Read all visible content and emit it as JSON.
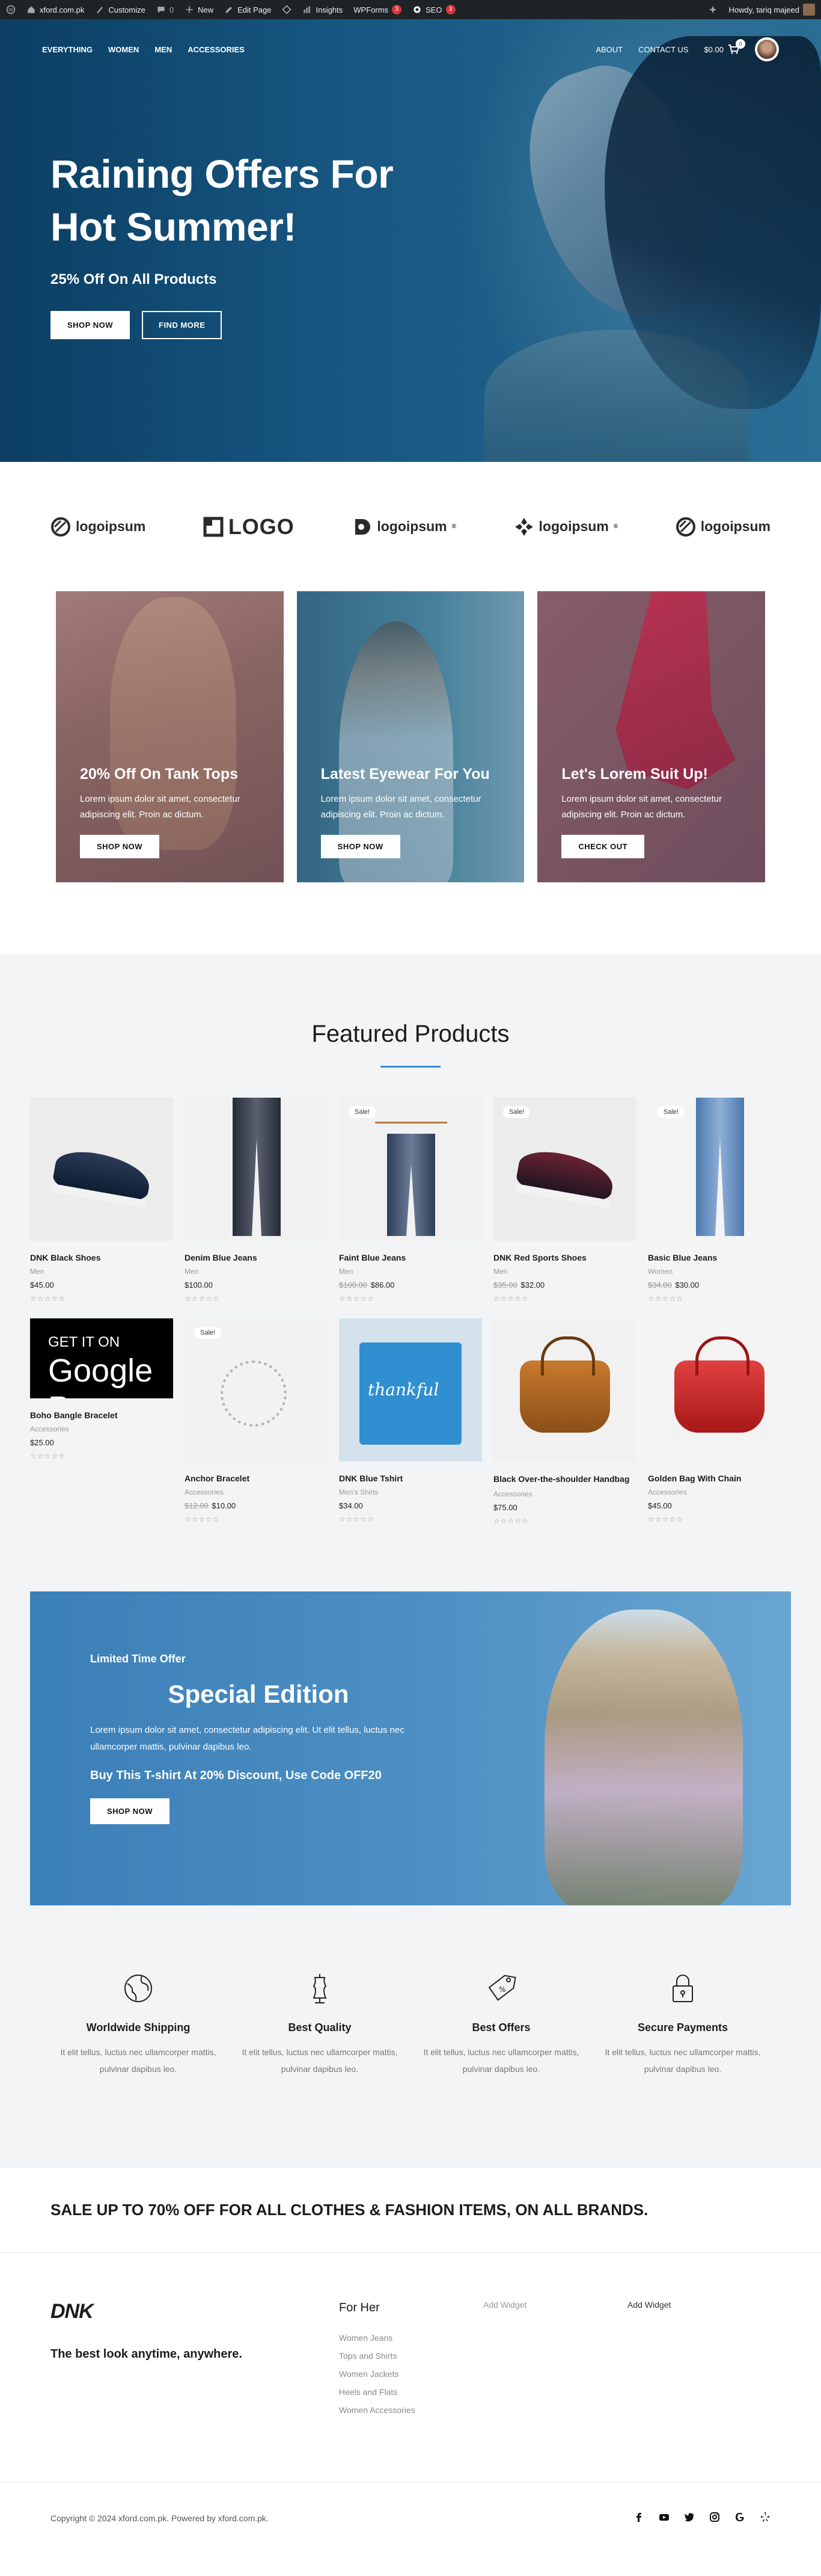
{
  "adminbar": {
    "site": "xford.com.pk",
    "customize": "Customize",
    "comments": "0",
    "new": "New",
    "edit": "Edit Page",
    "insights": "Insights",
    "wpforms": "WPForms",
    "wpforms_count": "3",
    "seo": "SEO",
    "seo_count": "3",
    "howdy": "Howdy, tariq majeed"
  },
  "nav": {
    "links": [
      "EVERYTHING",
      "WOMEN",
      "MEN",
      "ACCESSORIES"
    ],
    "right": [
      "ABOUT",
      "CONTACT US"
    ],
    "cart_total": "$0.00",
    "cart_count": "0"
  },
  "hero": {
    "line1": "Raining Offers For",
    "line2": "Hot Summer!",
    "subtitle": "25% Off On All Products",
    "btn_shop": "SHOP NOW",
    "btn_find": "FIND MORE"
  },
  "logos": [
    {
      "text": "logoipsum",
      "icon": "circle-slash-logo-icon"
    },
    {
      "text": "LOGO",
      "icon": "square-logo-icon"
    },
    {
      "text": "logoipsum",
      "icon": "half-moon-logo-icon",
      "tm": "®"
    },
    {
      "text": "logoipsum",
      "icon": "diamond-dots-logo-icon",
      "tm": "®"
    },
    {
      "text": "logoipsum",
      "icon": "circle-slash-logo-icon"
    }
  ],
  "promos": [
    {
      "title": "20% Off On Tank Tops",
      "desc": "Lorem ipsum dolor sit amet, consectetur adipiscing elit. Proin ac dictum.",
      "btn": "SHOP NOW"
    },
    {
      "title": "Latest Eyewear For You",
      "desc": "Lorem ipsum dolor sit amet, consectetur adipiscing elit. Proin ac dictum.",
      "btn": "SHOP NOW"
    },
    {
      "title": "Let's Lorem Suit Up!",
      "desc": "Lorem ipsum dolor sit amet, consectetur adipiscing elit. Proin ac dictum.",
      "btn": "CHECK OUT"
    }
  ],
  "featured": {
    "title": "Featured Products",
    "stars": "☆☆☆☆☆",
    "sale_label": "Sale!",
    "products": [
      {
        "name": "DNK Black Shoes",
        "cat": "Men",
        "price": "$45.00",
        "old": ""
      },
      {
        "name": "Denim Blue Jeans",
        "cat": "Men",
        "price": "$100.00",
        "old": ""
      },
      {
        "name": "Faint Blue Jeans",
        "cat": "Men",
        "price": "$86.00",
        "old": "$100.00"
      },
      {
        "name": "DNK Red Sports Shoes",
        "cat": "Men",
        "price": "$32.00",
        "old": "$35.00"
      },
      {
        "name": "Basic Blue Jeans",
        "cat": "Women",
        "price": "$30.00",
        "old": "$34.00"
      },
      {
        "name": "Boho Bangle Bracelet",
        "cat": "Accessories",
        "price": "$25.00",
        "old": ""
      },
      {
        "name": "Anchor Bracelet",
        "cat": "Accessories",
        "price": "$10.00",
        "old": "$12.00"
      },
      {
        "name": "DNK Blue Tshirt",
        "cat": "Men's Shirts",
        "price": "$34.00",
        "old": ""
      },
      {
        "name": "Black Over-the-shoulder Handbag",
        "cat": "Accessories",
        "price": "$75.00",
        "old": ""
      },
      {
        "name": "Golden Bag With Chain",
        "cat": "Accessories",
        "price": "$45.00",
        "old": ""
      }
    ],
    "google_t1": "GET IT ON",
    "google_t2": "Google P",
    "tshirt_text": "thankful"
  },
  "special": {
    "tag": "Limited Time Offer",
    "title": "Special Edition",
    "desc": "Lorem ipsum dolor sit amet, consectetur adipiscing elit. Ut elit tellus, luctus nec ullamcorper mattis, pulvinar dapibus leo.",
    "offer": "Buy This T-shirt At 20% Discount, Use Code OFF20",
    "btn": "SHOP NOW"
  },
  "features": [
    {
      "title": "Worldwide Shipping",
      "desc": "It elit tellus, luctus nec ullamcorper mattis, pulvinar dapibus leo.",
      "icon": "globe-icon"
    },
    {
      "title": "Best Quality",
      "desc": "It elit tellus, luctus nec ullamcorper mattis, pulvinar dapibus leo.",
      "icon": "dress-form-icon"
    },
    {
      "title": "Best Offers",
      "desc": "It elit tellus, luctus nec ullamcorper mattis, pulvinar dapibus leo.",
      "icon": "price-tag-icon"
    },
    {
      "title": "Secure Payments",
      "desc": "It elit tellus, luctus nec ullamcorper mattis, pulvinar dapibus leo.",
      "icon": "padlock-icon"
    }
  ],
  "salebar": "SALE UP TO 70% OFF FOR ALL CLOTHES & FASHION ITEMS, ON ALL BRANDS.",
  "footer": {
    "logo": "DNK",
    "tagline": "The best look anytime, anywhere.",
    "for_her": "For Her",
    "links": [
      "Women Jeans",
      "Tops and Shirts",
      "Women Jackets",
      "Heels and Flats",
      "Women Accessories"
    ],
    "widget1": "Add Widget",
    "widget2": "Add Widget",
    "copyright": "Copyright © 2024 xford.com.pk. Powered by xford.com.pk."
  }
}
